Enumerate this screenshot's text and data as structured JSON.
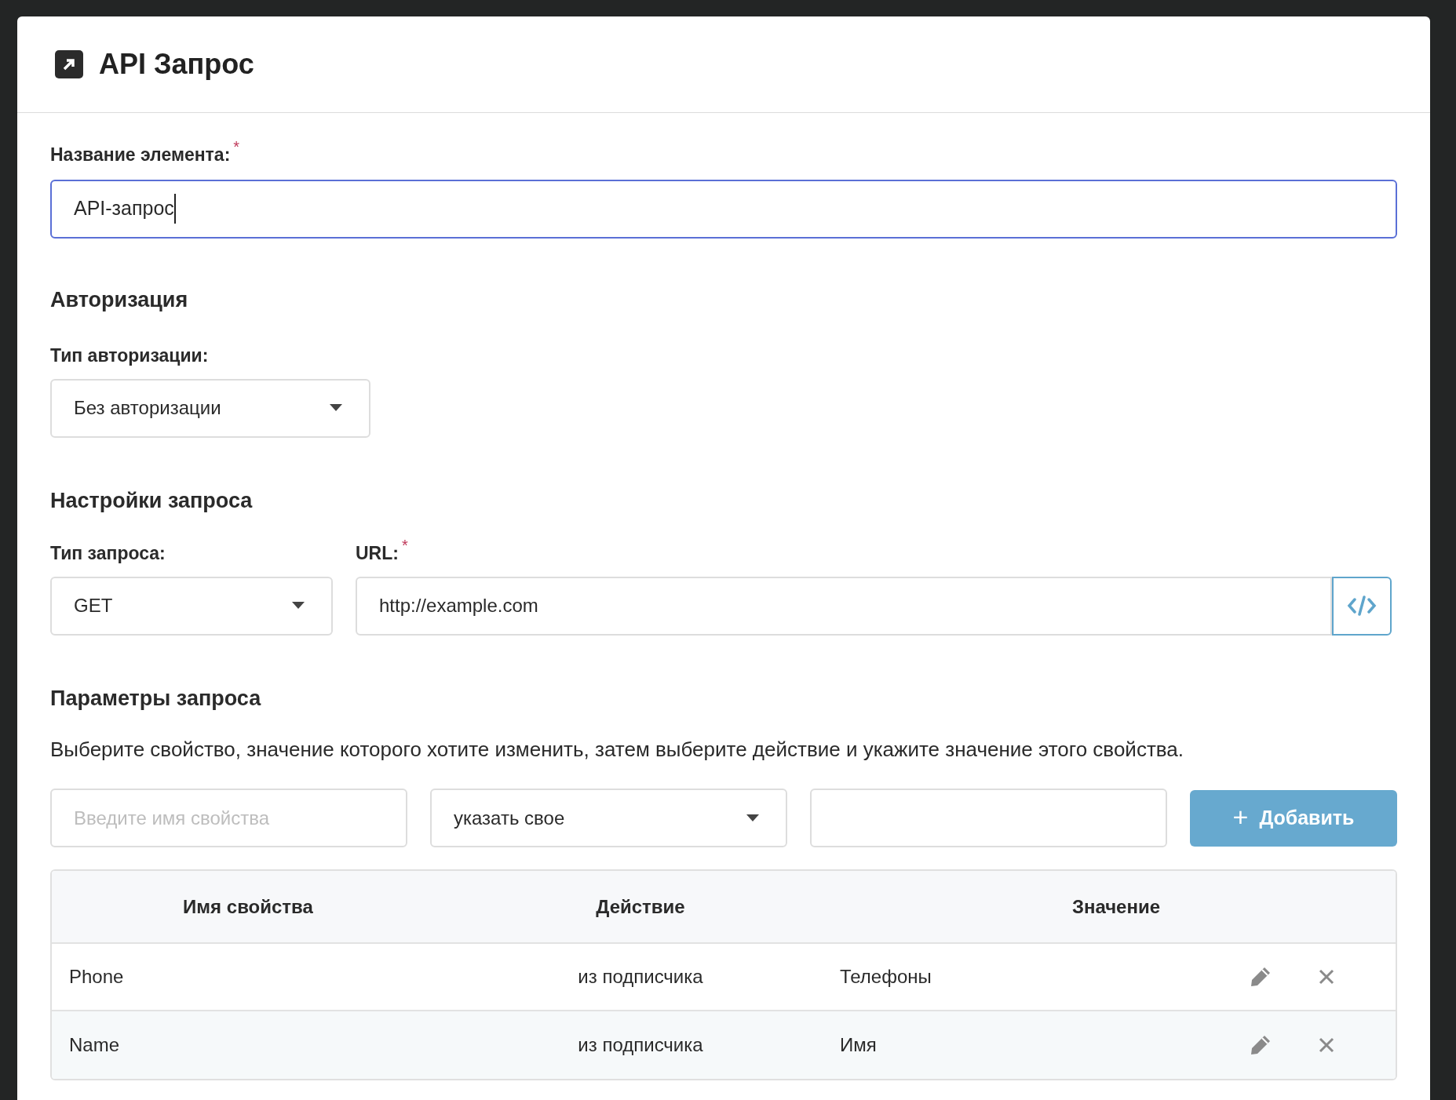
{
  "dialog": {
    "title": "API Запрос"
  },
  "name_field": {
    "label": "Название элемента:",
    "required_mark": "*",
    "value": "API-запрос",
    "focused": true
  },
  "auth": {
    "heading": "Авторизация",
    "type_label": "Тип авторизации:",
    "type_value": "Без авторизации"
  },
  "request": {
    "heading": "Настройки запроса",
    "method_label": "Тип запроса:",
    "method_value": "GET",
    "url_label": "URL:",
    "url_required_mark": "*",
    "url_value": "http://example.com"
  },
  "params": {
    "heading": "Параметры запроса",
    "description": "Выберите свойство, значение которого хотите изменить, затем выберите действие и укажите значение этого свойства.",
    "name_placeholder": "Введите имя свойства",
    "action_value": "указать свое",
    "add_button": "+",
    "add_label": "Добавить",
    "columns": [
      "Имя свойства",
      "Действие",
      "Значение"
    ],
    "rows": [
      {
        "name": "Phone",
        "action": "из подписчика",
        "value": "Телефоны"
      },
      {
        "name": "Name",
        "action": "из подписчика",
        "value": "Имя"
      }
    ]
  }
}
